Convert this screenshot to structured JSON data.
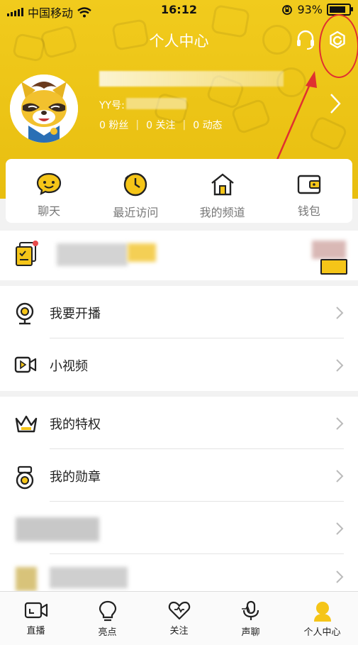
{
  "status_bar": {
    "carrier": "中国移动",
    "time": "16:12",
    "battery": "93%"
  },
  "header": {
    "title": "个人中心",
    "yy_label": "YY号:",
    "stats": [
      {
        "value": "0",
        "label": "粉丝"
      },
      {
        "value": "0",
        "label": "关注"
      },
      {
        "value": "0",
        "label": "动态"
      }
    ]
  },
  "quick_actions": [
    {
      "label": "聊天",
      "icon": "chat-icon"
    },
    {
      "label": "最近访问",
      "icon": "clock-icon"
    },
    {
      "label": "我的频道",
      "icon": "house-icon"
    },
    {
      "label": "钱包",
      "icon": "wallet-icon"
    }
  ],
  "menu_section_1": [
    {
      "label": "我要开播",
      "icon": "webcam-icon"
    },
    {
      "label": "小视频",
      "icon": "video-icon"
    }
  ],
  "menu_section_2": [
    {
      "label": "我的特权",
      "icon": "crown-icon"
    },
    {
      "label": "我的勋章",
      "icon": "medal-icon"
    }
  ],
  "tab_bar": [
    {
      "label": "直播",
      "icon": "live-camera-icon"
    },
    {
      "label": "亮点",
      "icon": "bulb-icon"
    },
    {
      "label": "关注",
      "icon": "heart-icon"
    },
    {
      "label": "声聊",
      "icon": "microphone-icon"
    },
    {
      "label": "个人中心",
      "icon": "profile-icon"
    }
  ],
  "colors": {
    "header_yellow": "#f1cb1d",
    "accent_yellow": "#f5c518",
    "annotation_red": "#e03030"
  }
}
